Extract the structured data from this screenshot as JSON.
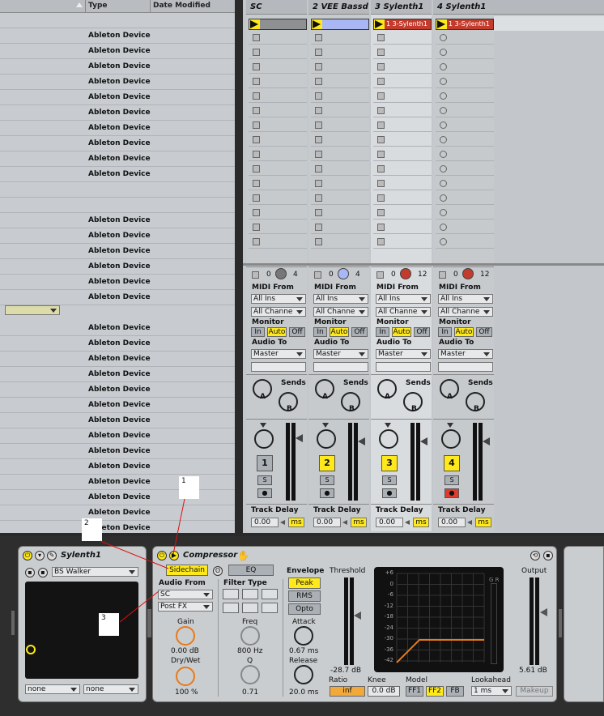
{
  "browser": {
    "columns": {
      "type": "Type",
      "date_modified": "Date Modified"
    },
    "rows": [
      {
        "type": ""
      },
      {
        "type": "Ableton Device"
      },
      {
        "type": "Ableton Device"
      },
      {
        "type": "Ableton Device"
      },
      {
        "type": "Ableton Device"
      },
      {
        "type": "Ableton Device"
      },
      {
        "type": "Ableton Device"
      },
      {
        "type": "Ableton Device"
      },
      {
        "type": "Ableton Device"
      },
      {
        "type": "Ableton Device"
      },
      {
        "type": "Ableton Device"
      },
      {
        "type": ""
      },
      {
        "type": ""
      },
      {
        "type": "Ableton Device"
      },
      {
        "type": "Ableton Device"
      },
      {
        "type": "Ableton Device"
      },
      {
        "type": "Ableton Device"
      },
      {
        "type": "Ableton Device"
      },
      {
        "type": "Ableton Device"
      },
      {
        "type": "Ableton Device"
      },
      {
        "type": "Ableton Device"
      },
      {
        "type": "Ableton Device"
      },
      {
        "type": "Ableton Device"
      },
      {
        "type": "Ableton Device"
      },
      {
        "type": "Ableton Device"
      },
      {
        "type": "Ableton Device"
      },
      {
        "type": "Ableton Device"
      },
      {
        "type": "Ableton Device"
      },
      {
        "type": "Ableton Device"
      },
      {
        "type": "Ableton Device"
      },
      {
        "type": "Ableton Device"
      },
      {
        "type": "Ableton Device"
      },
      {
        "type": "Ableton Device"
      },
      {
        "type": "Ableton Device"
      }
    ]
  },
  "tracks": [
    {
      "name": "SC",
      "clip": "",
      "clip_color": "#8f9091",
      "num": "4",
      "led": "#777",
      "midi_from": "All Ins",
      "channel": "All Channe",
      "audio_to": "Master",
      "track_num": "1",
      "num_active": false,
      "delay": "0.00"
    },
    {
      "name": "2 VEE Bassd",
      "clip": "",
      "clip_color": "#a9b8f5",
      "num": "4",
      "led": "#a9b8f5",
      "midi_from": "All Ins",
      "channel": "All Channe",
      "audio_to": "Master",
      "track_num": "2",
      "num_active": true,
      "delay": "0.00"
    },
    {
      "name": "3 Sylenth1",
      "clip": "1 3-Sylenth1",
      "clip_color": "#c23b2c",
      "num": "12",
      "led": "#c23b2c",
      "midi_from": "All Ins",
      "channel": "All Channe",
      "audio_to": "Master",
      "track_num": "3",
      "num_active": true,
      "delay": "0.00"
    },
    {
      "name": "4 Sylenth1",
      "clip": "1 3-Sylenth1",
      "clip_color": "#c23b2c",
      "num": "12",
      "led": "#c23b2c",
      "midi_from": "All Ins",
      "channel": "All Channe",
      "audio_to": "Master",
      "track_num": "4",
      "num_active": true,
      "delay": "0.00"
    }
  ],
  "io": {
    "midi_from": "MIDI From",
    "monitor": "Monitor",
    "monitor_in": "In",
    "monitor_auto": "Auto",
    "monitor_off": "Off",
    "audio_to": "Audio To",
    "sends": "Sends",
    "send_a": "A",
    "send_b": "B",
    "solo": "S",
    "track_delay": "Track Delay",
    "ms": "ms"
  },
  "sylenth": {
    "title": "Sylenth1",
    "preset": "BS Walker",
    "bottom_left": "none",
    "bottom_right": "none"
  },
  "compressor": {
    "title": "Compressor",
    "sidechain": "Sidechain",
    "eq": "EQ",
    "audio_from_label": "Audio From",
    "audio_from": "SC",
    "audio_from_tap": "Post FX",
    "gain_label": "Gain",
    "gain": "0.00 dB",
    "drywet_label": "Dry/Wet",
    "drywet": "100 %",
    "filter_type": "Filter Type",
    "freq_label": "Freq",
    "freq": "800 Hz",
    "q_label": "Q",
    "q": "0.71",
    "envelope": "Envelope",
    "peak": "Peak",
    "rms": "RMS",
    "opto": "Opto",
    "attack_label": "Attack",
    "attack": "0.67 ms",
    "release_label": "Release",
    "release": "20.0 ms",
    "threshold_label": "Threshold",
    "threshold": "-28.7 dB",
    "ratio_label": "Ratio",
    "ratio": "inf",
    "knee_label": "Knee",
    "knee": "0.0 dB",
    "model_label": "Model",
    "model_ff1": "FF1",
    "model_ff2": "FF2",
    "model_fb": "FB",
    "lookahead_label": "Lookahead",
    "lookahead": "1 ms",
    "makeup": "Makeup",
    "output_label": "Output",
    "output": "5.61 dB",
    "gr_label": "G R",
    "scale": [
      "+6",
      "0",
      "-6",
      "-12",
      "-18",
      "-24",
      "-30",
      "-36",
      "-42"
    ]
  },
  "callouts": [
    "1",
    "2",
    "3"
  ]
}
